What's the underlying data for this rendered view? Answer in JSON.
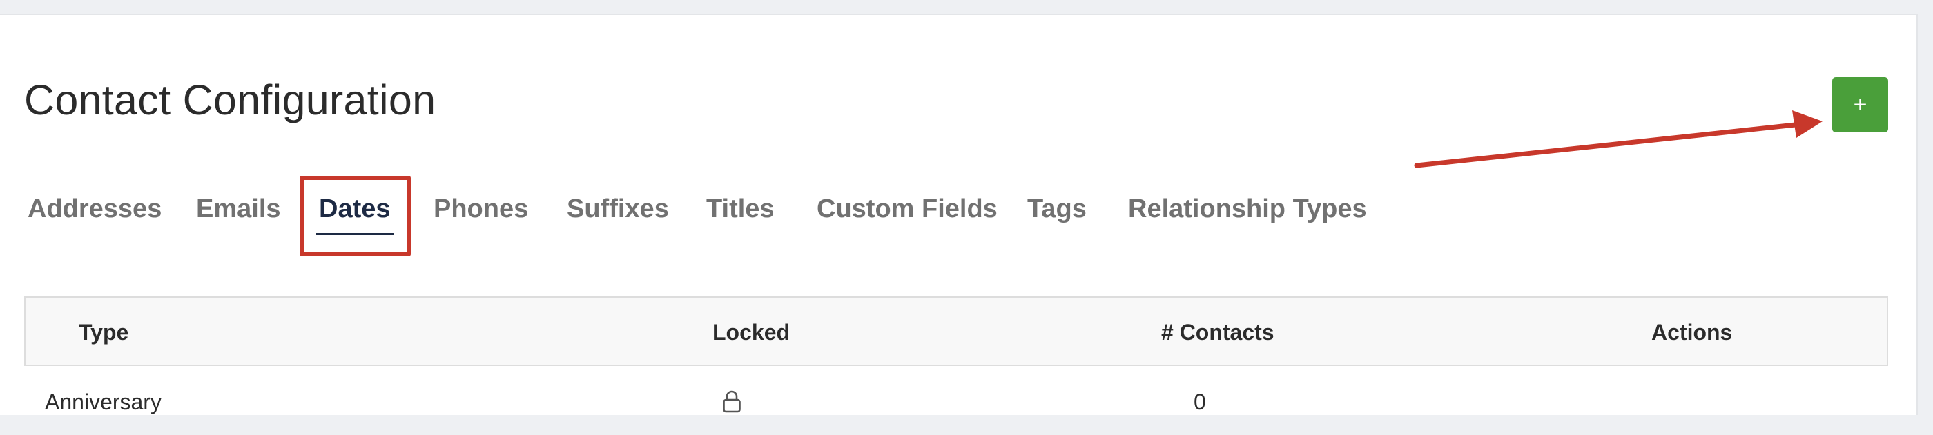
{
  "page": {
    "title": "Contact Configuration"
  },
  "add_button": {
    "label": "+",
    "color": "#4a9f3a"
  },
  "tabs": [
    {
      "label": "Addresses",
      "active": false
    },
    {
      "label": "Emails",
      "active": false
    },
    {
      "label": "Dates",
      "active": true
    },
    {
      "label": "Phones",
      "active": false
    },
    {
      "label": "Suffixes",
      "active": false
    },
    {
      "label": "Titles",
      "active": false
    },
    {
      "label": "Custom Fields",
      "active": false
    },
    {
      "label": "Tags",
      "active": false
    },
    {
      "label": "Relationship Types",
      "active": false
    }
  ],
  "table": {
    "columns": [
      "Type",
      "Locked",
      "# Contacts",
      "Actions"
    ],
    "rows": [
      {
        "type": "Anniversary",
        "locked_icon": "lock-icon",
        "contacts": "0"
      }
    ]
  },
  "annotations": {
    "highlight_color": "#c8382b",
    "arrow_color": "#c8382b"
  }
}
